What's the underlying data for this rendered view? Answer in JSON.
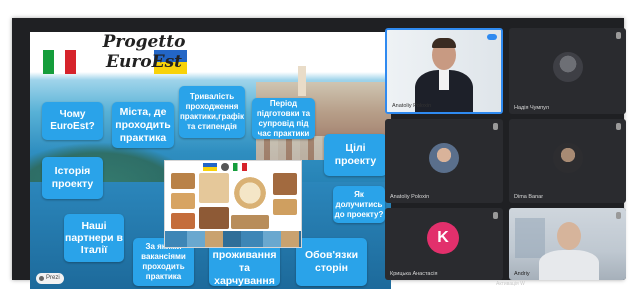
{
  "presentation": {
    "title_line1": "Progetto",
    "title_line2": "EuroEst",
    "buttons": {
      "why_euroest": "Чому EuroEst?",
      "cities": "Міста, де проходить практика",
      "duration": "Тривалість проходження практики,графік та стипендія",
      "preparation": "Період підготовки та супровід під час практики",
      "goals": "Цілі проекту",
      "history": "Історія проекту",
      "join": "Як долучитись до проекту?",
      "partners": "Наші партнери в Італії",
      "vacancies": "За якими вакансіями проходить практика",
      "conditions": "Умови проживання та харчування",
      "duties": "Обов'язки сторін"
    },
    "prezi_label": "Prezi"
  },
  "participants": [
    {
      "name": "Anatoliy Poloxin",
      "avatar": "photo"
    },
    {
      "name": "Надія Чумпул",
      "avatar": "photo"
    },
    {
      "name": "Anatoliy Poloxin",
      "avatar": "photo"
    },
    {
      "name": "Dima Banar",
      "avatar": "photo"
    },
    {
      "name": "Крицька Анастасія",
      "avatar": "letter",
      "initial": "K",
      "color": "#e2306c"
    },
    {
      "name": "Andriy",
      "avatar": "video"
    }
  ],
  "colors": {
    "button_blue": "#2aa3e9",
    "active_speaker_border": "#2f8af0",
    "tile_background": "#2a2b2f"
  },
  "icons": [
    "flag-italy-icon",
    "flag-ukraine-icon",
    "mic-muted-icon",
    "prezi-logo-icon"
  ],
  "watermark": "Активація W"
}
